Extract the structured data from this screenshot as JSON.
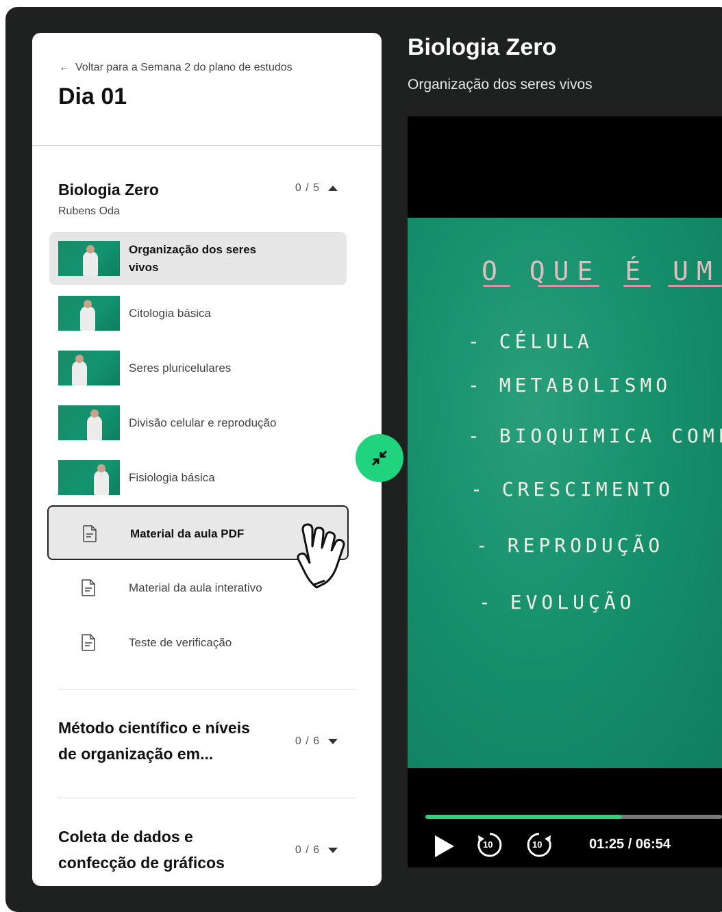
{
  "sidebar": {
    "back_link": "Voltar para a Semana 2 do plano de estudos",
    "day_title": "Dia 01",
    "courses": [
      {
        "title": "Biologia Zero",
        "teacher": "Rubens Oda",
        "progress": "0 / 5",
        "expanded": true,
        "lessons": [
          {
            "label": "Organização dos seres vivos",
            "active": true
          },
          {
            "label": "Citologia básica",
            "active": false
          },
          {
            "label": "Seres pluricelulares",
            "active": false
          },
          {
            "label": "Divisão celular e reprodução",
            "active": false
          },
          {
            "label": "Fisiologia básica",
            "active": false
          }
        ],
        "materials": [
          {
            "label": "Material da aula PDF",
            "icon": "document-icon"
          },
          {
            "label": "Material da aula interativo",
            "icon": "document-icon"
          },
          {
            "label": "Teste de verificação",
            "icon": "document-icon"
          }
        ]
      },
      {
        "title_line1": "Método científico e níveis",
        "title_line2": "de organização em...",
        "progress": "0 / 6",
        "expanded": false
      },
      {
        "title_line1": "Coleta de dados e",
        "title_line2": "confecção de gráficos",
        "progress": "0 / 6",
        "expanded": false
      }
    ]
  },
  "main": {
    "title": "Biologia Zero",
    "subtitle": "Organização dos seres vivos",
    "board": {
      "heading": "O QUE É UM",
      "lines": [
        "- CÉLULA",
        "- METABOLISMO",
        "- BIOQUIMICA COMP",
        "- CRESCIMENTO",
        "- REPRODUÇÃO",
        "- EVOLUÇÃO"
      ]
    },
    "player": {
      "time": "01:25 / 06:54",
      "progress_fraction": 0.66,
      "rewind_label": "10",
      "forward_label": "10"
    }
  },
  "colors": {
    "accent": "#1fd47d",
    "progress": "#33d07a",
    "background": "#1f2120",
    "board": "#17906c"
  }
}
